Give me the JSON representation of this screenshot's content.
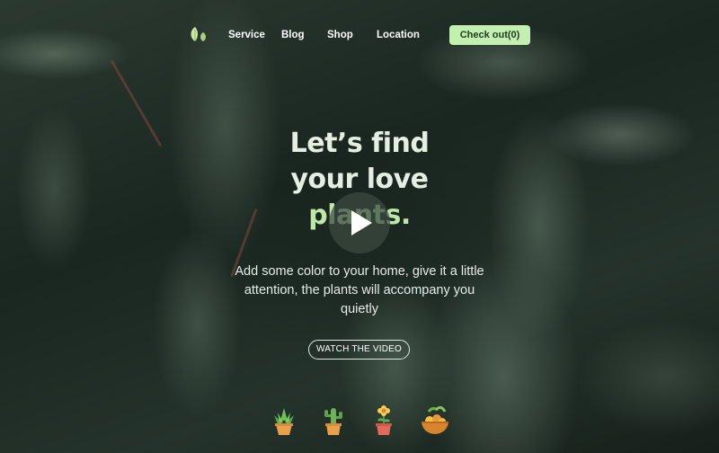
{
  "nav": {
    "logo_icon": "leaf-logo-icon",
    "links": [
      "Service",
      "Blog",
      "Shop",
      "Location"
    ],
    "checkout_label": "Check out(0)"
  },
  "hero": {
    "title_line1": "Let’s find",
    "title_line2": "your love",
    "title_line3": "plants.",
    "subtitle": "Add some color to your home, give it a little attention, the plants will accompany you quietly",
    "cta_label": "WATCH THE VIDEO",
    "play_icon": "play-icon"
  },
  "plants": [
    {
      "icon": "succulent-pot-icon"
    },
    {
      "icon": "cactus-pot-icon"
    },
    {
      "icon": "flower-pot-icon"
    },
    {
      "icon": "fruit-bowl-icon"
    }
  ],
  "colors": {
    "accent": "#c3f0b1",
    "title_highlight": "#bde7a9"
  }
}
